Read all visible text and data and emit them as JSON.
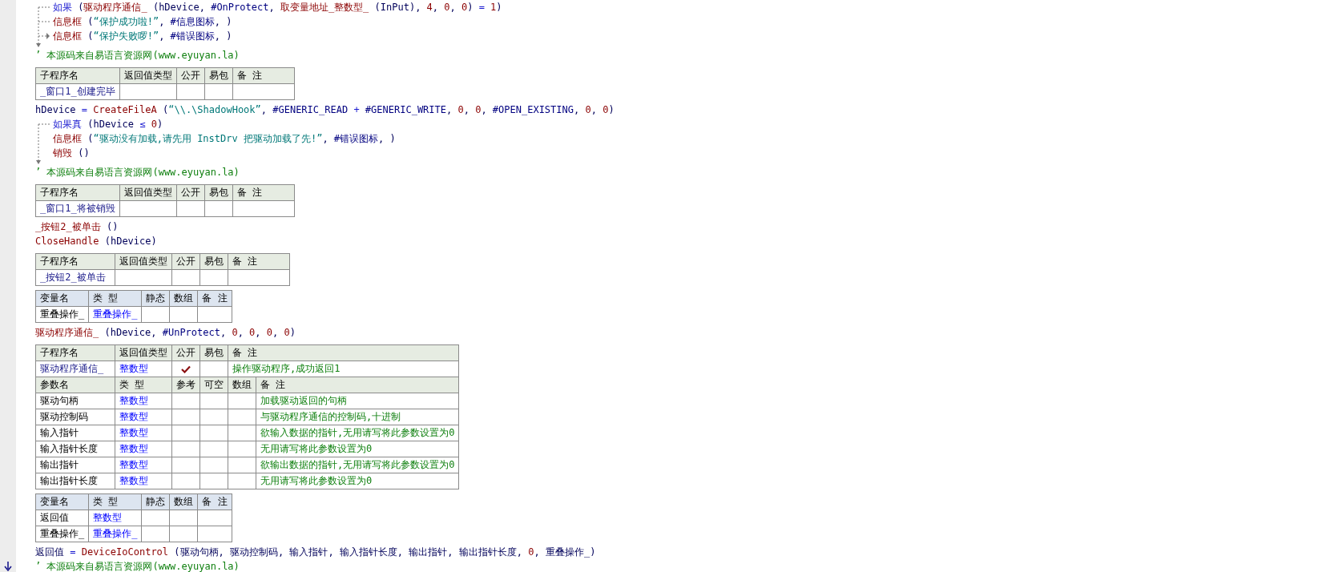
{
  "items": [
    {
      "kind": "if",
      "else": true,
      "head": [
        {
          "kind": "kw",
          "text": "如果"
        },
        {
          "kind": "plain",
          "text": " ("
        },
        {
          "kind": "func",
          "text": "驱动程序通信_"
        },
        {
          "kind": "plain",
          "text": " (hDevice, "
        },
        {
          "kind": "const",
          "text": "#OnProtect"
        },
        {
          "kind": "plain",
          "text": ", "
        },
        {
          "kind": "func",
          "text": "取变量地址_整数型_"
        },
        {
          "kind": "plain",
          "text": " (InPut), "
        },
        {
          "kind": "num",
          "text": "4"
        },
        {
          "kind": "plain",
          "text": ", "
        },
        {
          "kind": "num",
          "text": "0"
        },
        {
          "kind": "plain",
          "text": ", "
        },
        {
          "kind": "num",
          "text": "0"
        },
        {
          "kind": "plain",
          "text": ")"
        },
        {
          "kind": "op",
          "text": " = "
        },
        {
          "kind": "num",
          "text": "1"
        },
        {
          "kind": "plain",
          "text": ")"
        }
      ],
      "children": [
        [
          {
            "kind": "func",
            "text": "信息框"
          },
          {
            "kind": "plain",
            "text": " ("
          },
          {
            "kind": "str",
            "text": "“保护成功啦!”"
          },
          {
            "kind": "plain",
            "text": ", "
          },
          {
            "kind": "const",
            "text": "#信息图标"
          },
          {
            "kind": "plain",
            "text": ", )"
          }
        ],
        [
          {
            "kind": "func",
            "text": "信息框"
          },
          {
            "kind": "plain",
            "text": " ("
          },
          {
            "kind": "str",
            "text": "“保护失败啰!”"
          },
          {
            "kind": "plain",
            "text": ", "
          },
          {
            "kind": "const",
            "text": "#错误图标"
          },
          {
            "kind": "plain",
            "text": ", )"
          }
        ]
      ]
    },
    {
      "kind": "comment",
      "text": "’ 本源码来自易语言资源网(www.eyuyan.la)"
    },
    {
      "kind": "sub_table",
      "columns": [
        "子程序名",
        "返回值类型",
        "公开",
        "易包",
        "备 注"
      ],
      "name": "_窗口1_创建完毕",
      "public": false
    },
    {
      "kind": "code",
      "tokens": [
        {
          "kind": "plain",
          "text": "hDevice"
        },
        {
          "kind": "op",
          "text": " = "
        },
        {
          "kind": "func",
          "text": "CreateFileA"
        },
        {
          "kind": "plain",
          "text": " ("
        },
        {
          "kind": "str",
          "text": "“\\\\.\\ShadowHook”"
        },
        {
          "kind": "plain",
          "text": ", "
        },
        {
          "kind": "const",
          "text": "#GENERIC_READ"
        },
        {
          "kind": "op",
          "text": " + "
        },
        {
          "kind": "const",
          "text": "#GENERIC_WRITE"
        },
        {
          "kind": "plain",
          "text": ", "
        },
        {
          "kind": "num",
          "text": "0"
        },
        {
          "kind": "plain",
          "text": ", "
        },
        {
          "kind": "num",
          "text": "0"
        },
        {
          "kind": "plain",
          "text": ", "
        },
        {
          "kind": "const",
          "text": "#OPEN_EXISTING"
        },
        {
          "kind": "plain",
          "text": ", "
        },
        {
          "kind": "num",
          "text": "0"
        },
        {
          "kind": "plain",
          "text": ", "
        },
        {
          "kind": "num",
          "text": "0"
        },
        {
          "kind": "plain",
          "text": ")"
        }
      ]
    },
    {
      "kind": "if",
      "else": false,
      "head": [
        {
          "kind": "kw",
          "text": "如果真"
        },
        {
          "kind": "plain",
          "text": " (hDevice"
        },
        {
          "kind": "op",
          "text": " ≤ "
        },
        {
          "kind": "num",
          "text": "0"
        },
        {
          "kind": "plain",
          "text": ")"
        }
      ],
      "children": [
        [
          {
            "kind": "func",
            "text": "信息框"
          },
          {
            "kind": "plain",
            "text": " ("
          },
          {
            "kind": "str",
            "text": "“驱动没有加载,请先用 InstDrv 把驱动加载了先!”"
          },
          {
            "kind": "plain",
            "text": ", "
          },
          {
            "kind": "const",
            "text": "#错误图标"
          },
          {
            "kind": "plain",
            "text": ", )"
          }
        ],
        [
          {
            "kind": "func",
            "text": "销毁"
          },
          {
            "kind": "plain",
            "text": " ()"
          }
        ]
      ]
    },
    {
      "kind": "comment",
      "text": "’ 本源码来自易语言资源网(www.eyuyan.la)"
    },
    {
      "kind": "sub_table",
      "columns": [
        "子程序名",
        "返回值类型",
        "公开",
        "易包",
        "备 注"
      ],
      "name": "_窗口1_将被销毁",
      "public": false
    },
    {
      "kind": "code",
      "tokens": [
        {
          "kind": "func",
          "text": "_按钮2_被单击"
        },
        {
          "kind": "plain",
          "text": " ()"
        }
      ]
    },
    {
      "kind": "code",
      "tokens": [
        {
          "kind": "func",
          "text": "CloseHandle"
        },
        {
          "kind": "plain",
          "text": " (hDevice)"
        }
      ]
    },
    {
      "kind": "sub_table",
      "columns": [
        "子程序名",
        "返回值类型",
        "公开",
        "易包",
        "备 注"
      ],
      "name": "_按钮2_被单击",
      "public": false
    },
    {
      "kind": "var_table",
      "columns": [
        "变量名",
        "类 型",
        "静态",
        "数组",
        "备 注"
      ],
      "rows": [
        {
          "name": "重叠操作_",
          "type": "重叠操作_"
        }
      ]
    },
    {
      "kind": "code",
      "tokens": [
        {
          "kind": "func",
          "text": "驱动程序通信_"
        },
        {
          "kind": "plain",
          "text": " (hDevice, "
        },
        {
          "kind": "const",
          "text": "#UnProtect"
        },
        {
          "kind": "plain",
          "text": ", "
        },
        {
          "kind": "num",
          "text": "0"
        },
        {
          "kind": "plain",
          "text": ", "
        },
        {
          "kind": "num",
          "text": "0"
        },
        {
          "kind": "plain",
          "text": ", "
        },
        {
          "kind": "num",
          "text": "0"
        },
        {
          "kind": "plain",
          "text": ", "
        },
        {
          "kind": "num",
          "text": "0"
        },
        {
          "kind": "plain",
          "text": ")"
        }
      ]
    },
    {
      "kind": "sub_table",
      "columns": [
        "子程序名",
        "返回值类型",
        "公开",
        "易包",
        "备 注"
      ],
      "name": "驱动程序通信_",
      "type": "整数型",
      "public": true,
      "remark": "操作驱动程序,成功返回1",
      "param_columns": [
        "参数名",
        "类 型",
        "参考",
        "可空",
        "数组",
        "备 注"
      ],
      "params": [
        {
          "name": "驱动句柄",
          "type": "整数型",
          "remark": "加载驱动返回的句柄"
        },
        {
          "name": "驱动控制码",
          "type": "整数型",
          "remark": "与驱动程序通信的控制码,十进制"
        },
        {
          "name": "输入指针",
          "type": "整数型",
          "remark": "欲输入数据的指针,无用请写将此参数设置为0"
        },
        {
          "name": "输入指针长度",
          "type": "整数型",
          "remark": "无用请写将此参数设置为0"
        },
        {
          "name": "输出指针",
          "type": "整数型",
          "remark": "欲输出数据的指针,无用请写将此参数设置为0"
        },
        {
          "name": "输出指针长度",
          "type": "整数型",
          "remark": "无用请写将此参数设置为0"
        }
      ]
    },
    {
      "kind": "var_table",
      "columns": [
        "变量名",
        "类 型",
        "静态",
        "数组",
        "备 注"
      ],
      "rows": [
        {
          "name": "返回值",
          "type": "整数型"
        },
        {
          "name": "重叠操作_",
          "type": "重叠操作_"
        }
      ]
    },
    {
      "kind": "code",
      "tokens": [
        {
          "kind": "plain",
          "text": "返回值"
        },
        {
          "kind": "op",
          "text": " = "
        },
        {
          "kind": "func",
          "text": "DeviceIoControl"
        },
        {
          "kind": "plain",
          "text": " (驱动句柄, 驱动控制码, 输入指针, 输入指针长度, 输出指针, 输出指针长度, "
        },
        {
          "kind": "num",
          "text": "0"
        },
        {
          "kind": "plain",
          "text": ", 重叠操作_)"
        }
      ]
    },
    {
      "kind": "comment",
      "marker": true,
      "text": "’ 本源码来自易语言资源网(www.eyuyan.la)"
    }
  ]
}
